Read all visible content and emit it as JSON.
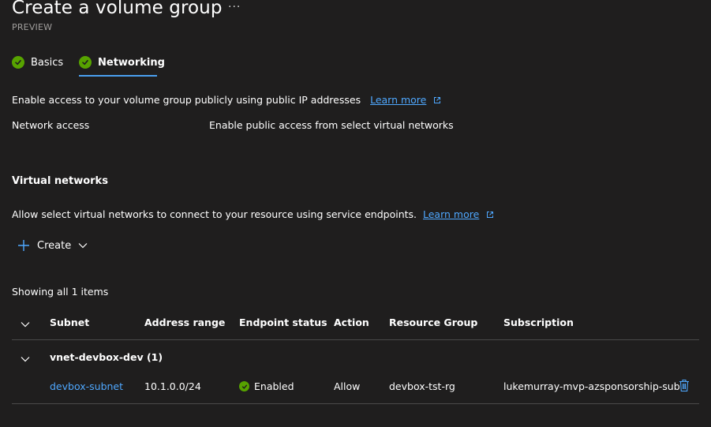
{
  "header": {
    "title": "Create a volume group",
    "more_label": "···",
    "subtitle": "PREVIEW"
  },
  "tabs": [
    {
      "label": "Basics",
      "state": "complete",
      "selected": false
    },
    {
      "label": "Networking",
      "state": "complete",
      "selected": true
    }
  ],
  "access": {
    "description": "Enable access to your volume group publicly using public IP addresses",
    "learn_more": "Learn more",
    "network_access_label": "Network access",
    "network_access_value": "Enable public access from select virtual networks"
  },
  "virtual_networks": {
    "title": "Virtual networks",
    "description": "Allow select virtual networks to connect to your resource using service endpoints.",
    "learn_more": "Learn more",
    "create_label": "Create",
    "showing": "Showing all 1 items"
  },
  "table": {
    "columns": [
      "Subnet",
      "Address range",
      "Endpoint status",
      "Action",
      "Resource Group",
      "Subscription"
    ],
    "group": {
      "name": "vnet-devbox-dev (1)",
      "rows": [
        {
          "subnet": "devbox-subnet",
          "address_range": "10.1.0.0/24",
          "endpoint_status": "Enabled",
          "action": "Allow",
          "resource_group": "devbox-tst-rg",
          "subscription": "lukemurray-mvp-azsponsorship-sub"
        }
      ]
    }
  },
  "icons": {
    "check": "checkmark-circle-icon",
    "external": "open-in-new-icon",
    "plus": "plus-icon",
    "chevron": "chevron-down-icon",
    "delete": "trash-icon"
  },
  "colors": {
    "background": "#1f1e1e",
    "accent": "#4fa8ff",
    "success": "#57a300",
    "muted": "#a19f9d"
  }
}
